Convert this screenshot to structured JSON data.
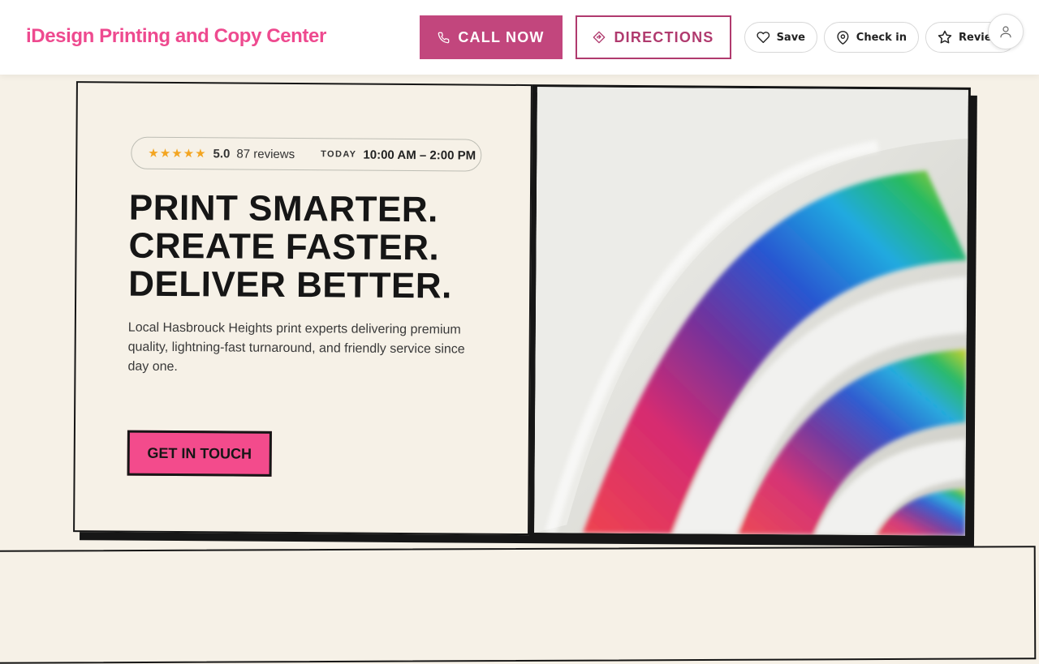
{
  "header": {
    "brand": "iDesign Printing and Copy Center",
    "call_label": "CALL NOW",
    "directions_label": "DIRECTIONS",
    "save_label": "Save",
    "checkin_label": "Check in",
    "review_label": "Review"
  },
  "hero": {
    "stars": "★★★★★",
    "rating": "5.0",
    "reviews": "87 reviews",
    "today_label": "TODAY",
    "hours": "10:00 AM – 2:00 PM",
    "headline": [
      "PRINT SMARTER.",
      "CREATE FASTER.",
      "DELIVER BETTER."
    ],
    "subcopy": "Local Hasbrouck Heights print experts delivering premium quality, lightning-fast turnaround, and friendly service since day one.",
    "cta_label": "GET IN TOUCH"
  },
  "colors": {
    "brand": "#ee4a8f",
    "call_button": "#c2467d",
    "outline_accent": "#b03a6e",
    "cta": "#f34b8c",
    "star": "#f3a521",
    "background": "#f6f1e7"
  },
  "icons": {
    "call": "phone-icon",
    "directions": "directions-icon",
    "save": "heart-icon",
    "checkin": "map-pin-icon",
    "review": "star-icon",
    "avatar": "user-icon"
  }
}
